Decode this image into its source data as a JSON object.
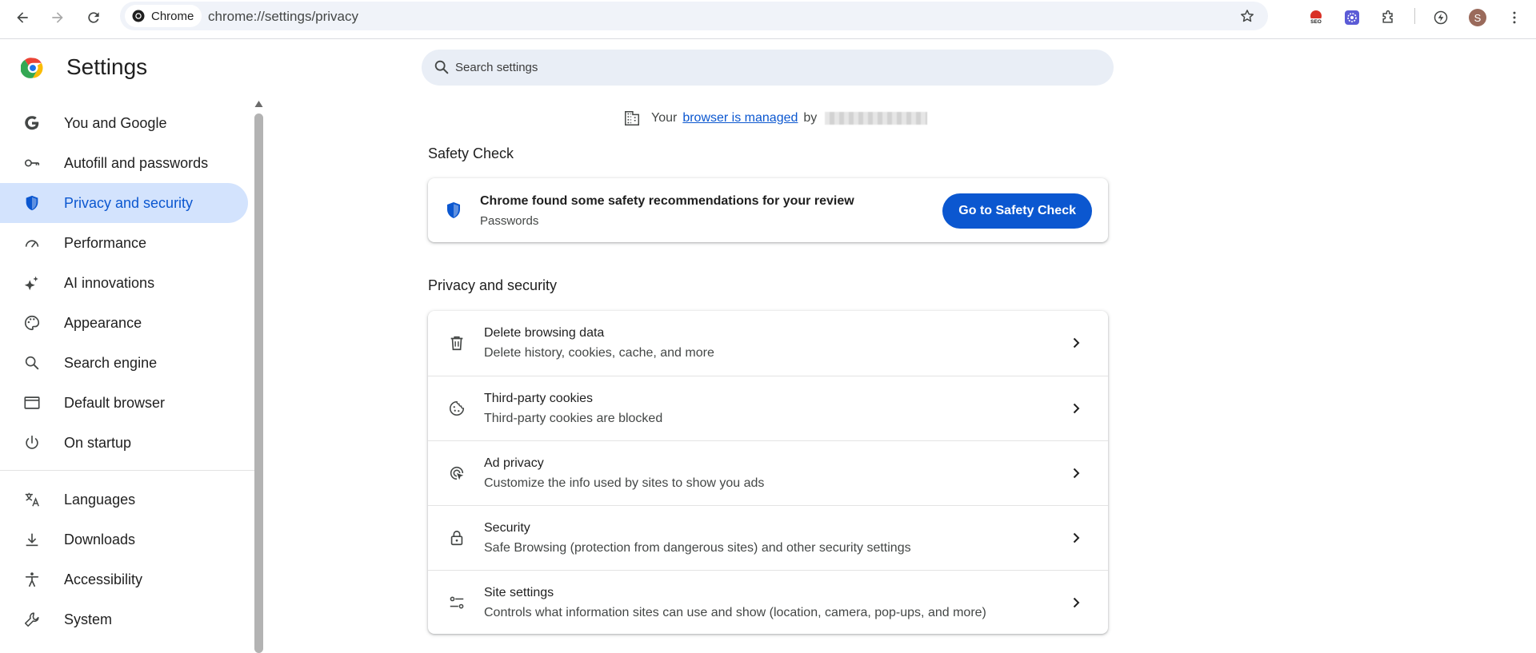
{
  "browser": {
    "site_chip": "Chrome",
    "url": "chrome://settings/privacy",
    "avatar_initial": "S",
    "extensions": [
      "seo-extension-icon",
      "flower-extension-icon",
      "puzzle-icon",
      "lightning-icon"
    ]
  },
  "header": {
    "title": "Settings",
    "search_placeholder": "Search settings"
  },
  "managed_notice": {
    "prefix": "Your",
    "link": "browser is managed",
    "suffix": "by"
  },
  "sidebar": {
    "items": [
      {
        "label": "You and Google",
        "icon": "google-g-icon",
        "active": false
      },
      {
        "label": "Autofill and passwords",
        "icon": "key-icon",
        "active": false
      },
      {
        "label": "Privacy and security",
        "icon": "shield-icon",
        "active": true
      },
      {
        "label": "Performance",
        "icon": "speedometer-icon",
        "active": false
      },
      {
        "label": "AI innovations",
        "icon": "sparkle-icon",
        "active": false
      },
      {
        "label": "Appearance",
        "icon": "palette-icon",
        "active": false
      },
      {
        "label": "Search engine",
        "icon": "search-icon",
        "active": false
      },
      {
        "label": "Default browser",
        "icon": "browser-window-icon",
        "active": false
      },
      {
        "label": "On startup",
        "icon": "power-icon",
        "active": false
      },
      {
        "label": "Languages",
        "icon": "translate-icon",
        "active": false
      },
      {
        "label": "Downloads",
        "icon": "download-icon",
        "active": false
      },
      {
        "label": "Accessibility",
        "icon": "accessibility-icon",
        "active": false
      },
      {
        "label": "System",
        "icon": "wrench-icon",
        "active": false
      }
    ]
  },
  "safety_check": {
    "section_title": "Safety Check",
    "title": "Chrome found some safety recommendations for your review",
    "subtitle": "Passwords",
    "button": "Go to Safety Check"
  },
  "privacy": {
    "section_title": "Privacy and security",
    "rows": [
      {
        "title": "Delete browsing data",
        "subtitle": "Delete history, cookies, cache, and more",
        "icon": "trash-icon"
      },
      {
        "title": "Third-party cookies",
        "subtitle": "Third-party cookies are blocked",
        "icon": "cookie-icon"
      },
      {
        "title": "Ad privacy",
        "subtitle": "Customize the info used by sites to show you ads",
        "icon": "ad-privacy-icon"
      },
      {
        "title": "Security",
        "subtitle": "Safe Browsing (protection from dangerous sites) and other security settings",
        "icon": "lock-icon"
      },
      {
        "title": "Site settings",
        "subtitle": "Controls what information sites can use and show (location, camera, pop-ups, and more)",
        "icon": "tune-icon"
      }
    ]
  },
  "colors": {
    "accent": "#0b57d0",
    "active_nav_bg": "#d3e3fd",
    "search_bg": "#e9eef6",
    "omnibox_bg": "#f0f3f9"
  }
}
